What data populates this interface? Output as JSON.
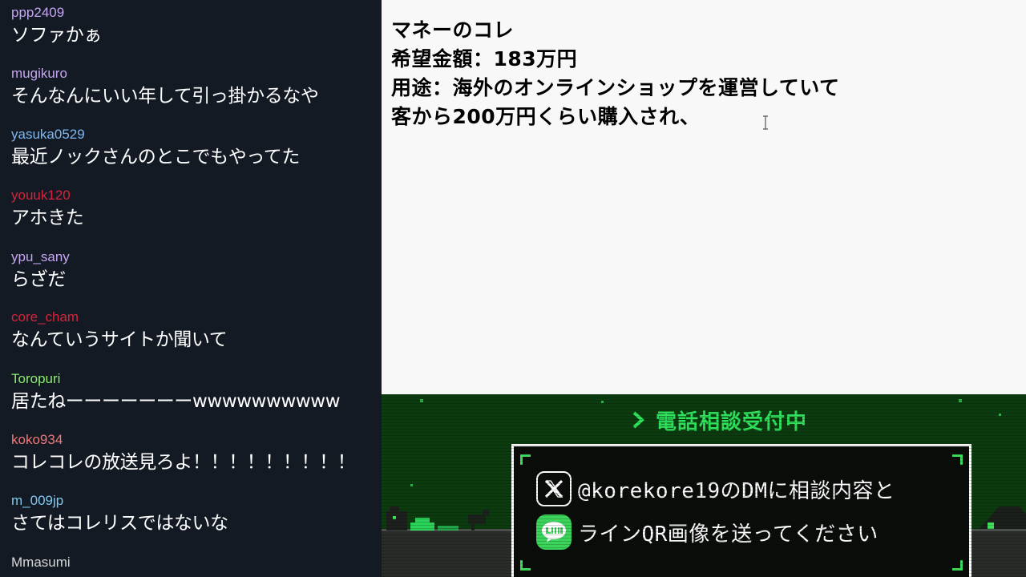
{
  "chat": {
    "messages": [
      {
        "user": "ppp2409",
        "text": "ソファかぁ",
        "color": "#c6a6f2"
      },
      {
        "user": "mugikuro",
        "text": "そんなんにいい年して引っ掛かるなや",
        "color": "#c6a6f2"
      },
      {
        "user": "yasuka0529",
        "text": "最近ノックさんのとこでもやってた",
        "color": "#7fb7f0"
      },
      {
        "user": "youuk120",
        "text": "アホきた",
        "color": "#d6243c"
      },
      {
        "user": "ypu_sany",
        "text": "らざだ",
        "color": "#c6a6f2"
      },
      {
        "user": "core_cham",
        "text": "なんていうサイトか聞いて",
        "color": "#d6243c"
      },
      {
        "user": "Toropuri",
        "text": "居たねーーーーーーーwwwwwwwwww",
        "color": "#8bea6e"
      },
      {
        "user": "koko934",
        "text": "コレコレの放送見ろよ！！！！！！！！！",
        "color": "#f07878"
      },
      {
        "user": "m_009jp",
        "text": "さてはコレリスではないな",
        "color": "#7fc8f0"
      },
      {
        "user": "Mmasumi",
        "text": "",
        "color": "#d8d8d8"
      }
    ]
  },
  "document": {
    "lines": [
      "マネーのコレ",
      "希望金額：183万円",
      "用途：海外のオンラインショップを運営していて",
      "客から200万円くらい購入され、"
    ]
  },
  "banner": {
    "heading": "電話相談受付中",
    "colors": {
      "accent": "#2fe25c",
      "background": "#0c3b10",
      "box": "#0b0d0b"
    },
    "rows": [
      {
        "icon": "x-logo-icon",
        "text": "@korekore19のDMに相談内容と"
      },
      {
        "icon": "line-logo-icon",
        "text": "ラインQR画像を送ってください"
      }
    ]
  }
}
